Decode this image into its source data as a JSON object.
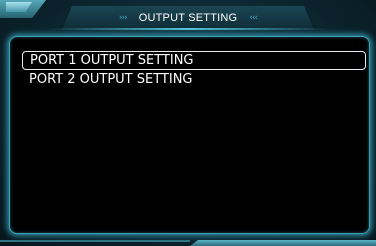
{
  "header": {
    "title": "OUTPUT SETTING",
    "left_chevrons": "›››",
    "right_chevrons": "‹‹‹"
  },
  "menu": {
    "items": [
      {
        "label": "PORT 1 OUTPUT SETTING",
        "selected": true
      },
      {
        "label": "PORT 2 OUTPUT SETTING",
        "selected": false
      }
    ]
  },
  "colors": {
    "background": "#0c2630",
    "panel": "#000000",
    "panel_glow": "#3e9fb4",
    "text": "#ffffff",
    "chevron": "#3aa6c0",
    "selection_border": "#e6eef0"
  }
}
